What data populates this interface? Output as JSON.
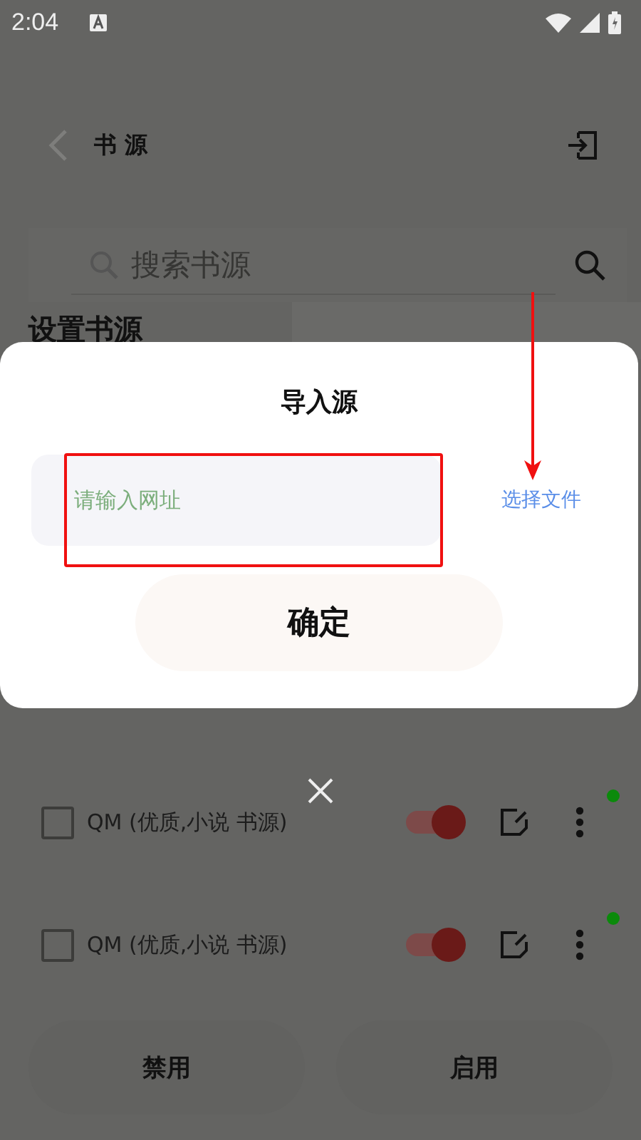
{
  "status_bar": {
    "time": "2:04"
  },
  "app_bar": {
    "title": "书 源"
  },
  "search": {
    "placeholder": "搜索书源"
  },
  "section_title": "设置书源",
  "dialog": {
    "title": "导入源",
    "url_field": {
      "placeholder": "请输入网址"
    },
    "choose_file_link": "选择文件",
    "confirm_button": "确定"
  },
  "sources": [
    {
      "name": "QM (优质,小说 书源)",
      "checked": false,
      "enabled": true,
      "color": "#0b8a0b"
    },
    {
      "name": "QM (优质,小说 书源)",
      "checked": false,
      "enabled": true,
      "color": "#0b8a0b"
    }
  ],
  "buttons": [
    "禁用",
    "启用"
  ],
  "annotations": {
    "highlight_box": true,
    "arrow": true
  }
}
